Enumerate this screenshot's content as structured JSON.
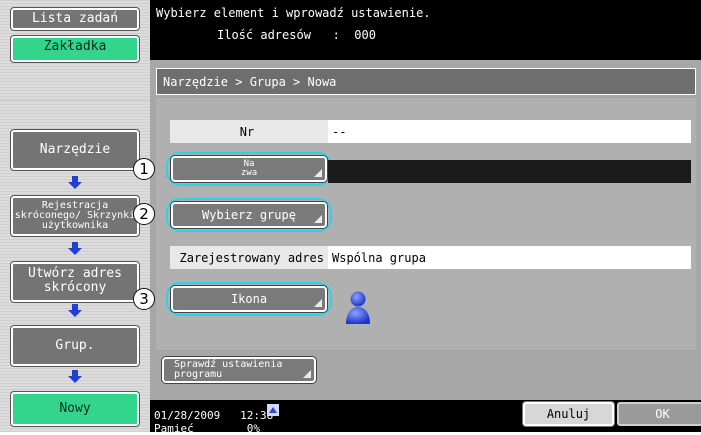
{
  "sidebar": {
    "job_list_label": "Lista zadań",
    "tab_label": "Zakładka",
    "steps": [
      {
        "label": "Narzędzie"
      },
      {
        "label": "Rejestracja skróconego/ Skrzynki użytkownika"
      },
      {
        "label": "Utwórz adres skrócony"
      },
      {
        "label": "Grup."
      },
      {
        "label": "Nowy"
      }
    ]
  },
  "header": {
    "message": "Wybierz element i wprowadź ustawienie.",
    "address_count": "Ilość adresów   :  000"
  },
  "breadcrumb": "Narzędzie > Grupa > Nowa",
  "form": {
    "nr_label": "Nr",
    "nr_value": "--",
    "name_button": "Na zwa",
    "name_callout": "1",
    "group_button": "Wybierz grupę",
    "group_callout": "2",
    "registered_label": "Zarejestrowany adres",
    "registered_value": "Wspólna grupa",
    "icon_button": "Ikona",
    "icon_callout": "3",
    "icon_preview": "user-icon"
  },
  "check_button": "Sprawdź ustawienia programu",
  "footer": {
    "date": "01/28/2009",
    "time": "12:38",
    "memory": "Pamięć",
    "memory_value": "0%",
    "cancel_label": "Anuluj",
    "ok_label": "OK"
  },
  "colors": {
    "accent_green": "#33d48c",
    "callout_cyan": "#2fd1e6",
    "arrow_blue": "#1f3fd6"
  }
}
